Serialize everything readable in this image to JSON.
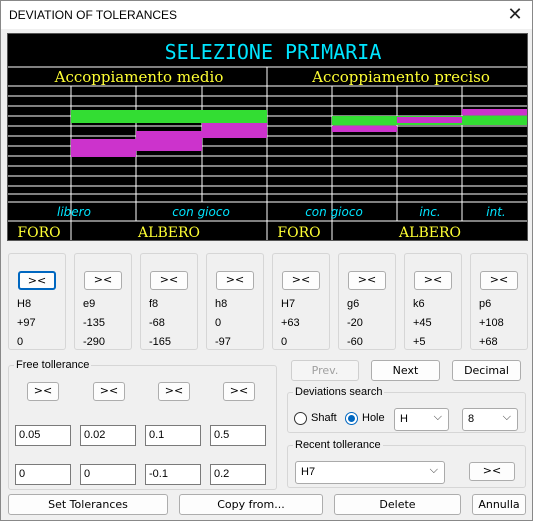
{
  "window": {
    "title": "DEVIATION OF TOLERANCES",
    "close_glyph": "✕"
  },
  "chart": {
    "title": "SELEZIONE PRIMARIA",
    "left_header": "Accoppiamento medio",
    "right_header": "Accoppiamento preciso",
    "zone_labels": [
      "libero",
      "con gioco",
      "con gioco",
      "inc.",
      "int."
    ],
    "bottom_labels": [
      "FORO",
      "ALBERO",
      "FORO",
      "ALBERO"
    ],
    "colors": {
      "title": "#00e5ff",
      "header": "#ffff33",
      "zone": "#00e5ff",
      "hole_band": "#33dd33",
      "shaft_band": "#cc33cc",
      "grid": "#ffffff"
    }
  },
  "columns": [
    {
      "button": "><",
      "name": "H8",
      "upper": "+97",
      "lower": "0"
    },
    {
      "button": "><",
      "name": "e9",
      "upper": "-135",
      "lower": "-290"
    },
    {
      "button": "><",
      "name": "f8",
      "upper": "-68",
      "lower": "-165"
    },
    {
      "button": "><",
      "name": "h8",
      "upper": "0",
      "lower": "-97"
    },
    {
      "button": "><",
      "name": "H7",
      "upper": "+63",
      "lower": "0"
    },
    {
      "button": "><",
      "name": "g6",
      "upper": "-20",
      "lower": "-60"
    },
    {
      "button": "><",
      "name": "k6",
      "upper": "+45",
      "lower": "+5"
    },
    {
      "button": "><",
      "name": "p6",
      "upper": "+108",
      "lower": "+68"
    }
  ],
  "free_tolerance": {
    "label": "Free tollerance",
    "buttons": [
      "><",
      "><",
      "><",
      "><"
    ],
    "upper_values": [
      "0.05",
      "0.02",
      "0.1",
      "0.5"
    ],
    "lower_values": [
      "0",
      "0",
      "-0.1",
      "0.2"
    ]
  },
  "nav": {
    "prev": "Prev.",
    "next": "Next",
    "decimal": "Decimal"
  },
  "deviations_search": {
    "label": "Deviations search",
    "shaft_label": "Shaft",
    "hole_label": "Hole",
    "selected": "Hole",
    "letter": "H",
    "grade": "8"
  },
  "recent": {
    "label": "Recent tollerance",
    "value": "H7",
    "button": "><"
  },
  "footer": {
    "set": "Set Tolerances",
    "copy": "Copy from...",
    "delete": "Delete",
    "cancel": "Annulla"
  }
}
